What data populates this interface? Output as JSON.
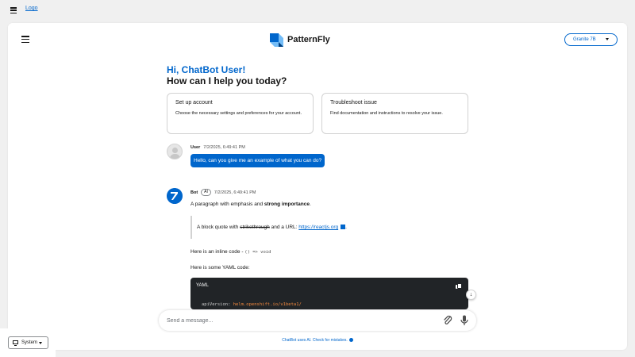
{
  "topbar": {
    "logo_link": "Logo",
    "menu_icon": "hamburger-menu-icon"
  },
  "header": {
    "brand_name": "PatternFly",
    "model_select": "Granite 7B"
  },
  "greeting": {
    "hi": "Hi, ChatBot User!",
    "help": "How can I help you today?"
  },
  "prompts": [
    {
      "title": "Set up account",
      "description": "Choose the necessary settings and preferences for your account."
    },
    {
      "title": "Troubleshoot issue",
      "description": "Find documentation and instructions to resolve your issue."
    }
  ],
  "messages": {
    "user": {
      "name": "User",
      "timestamp": "7/2/2025, 6:49:41 PM",
      "text": "Hello, can you give me an example of what you can do?"
    },
    "bot": {
      "name": "Bot",
      "badge": "AI",
      "timestamp": "7/2/2025, 6:49:41 PM",
      "para_prefix": "A paragraph with emphasis and ",
      "para_strong": "strong importance",
      "para_suffix": ".",
      "quote_prefix": "A block quote with ",
      "quote_strike": "strikethrough",
      "quote_mid": " and a URL: ",
      "quote_url": "https://reactjs.org",
      "quote_suffix": ".",
      "inline_prefix": "Here is an inline code - ",
      "inline_code": "() => void",
      "yaml_label": "Here is some YAML code:",
      "code_lang": "YAML",
      "code_key": "apiVersion: ",
      "code_value": "helm.openshift.io/v1beta1/"
    }
  },
  "composer": {
    "placeholder": "Send a message..."
  },
  "footnote": "ChatBot uses AI. Check for mistakes.",
  "theme_select": "System",
  "colors": {
    "accent": "#0066cc",
    "code_bg": "#212427",
    "page_bg": "#f0f0f0"
  }
}
